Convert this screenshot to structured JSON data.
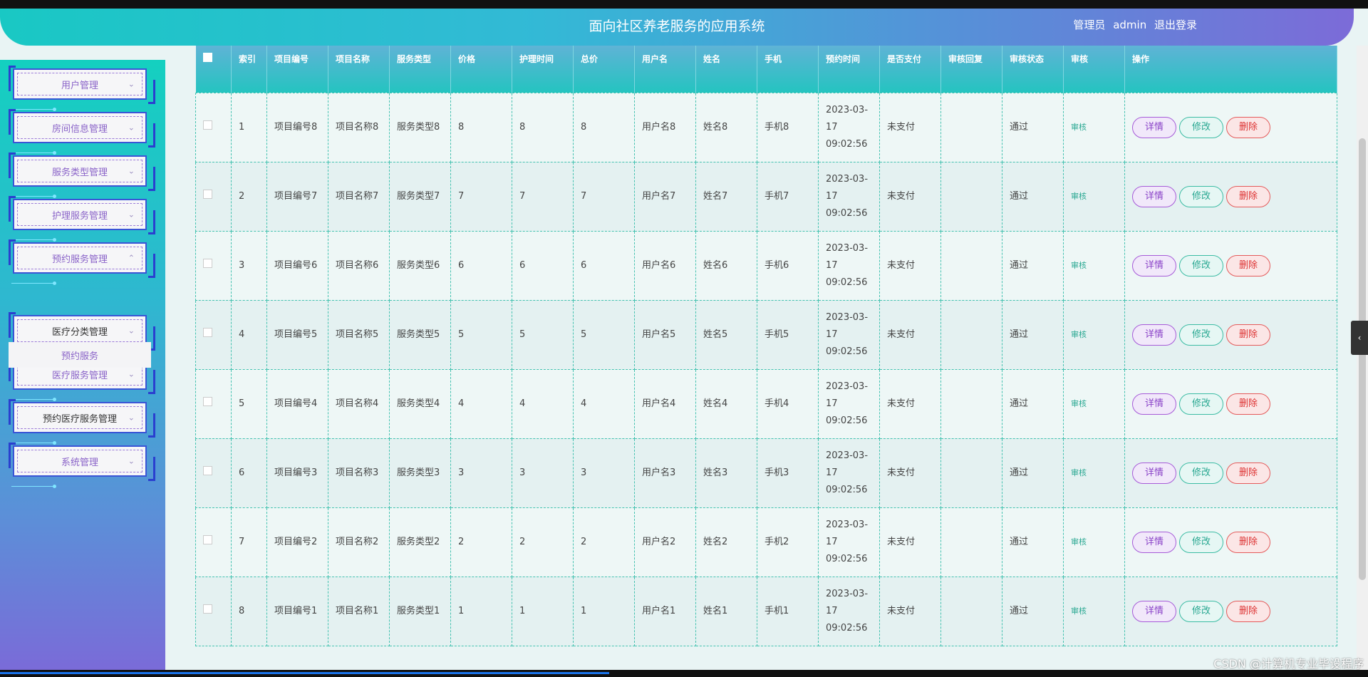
{
  "header": {
    "title": "面向社区养老服务的应用系统",
    "role": "管理员",
    "username": "admin",
    "logout": "退出登录"
  },
  "sidebar": {
    "items": [
      {
        "label": "用户管理"
      },
      {
        "label": "房间信息管理"
      },
      {
        "label": "服务类型管理"
      },
      {
        "label": "护理服务管理"
      },
      {
        "label": "预约服务管理"
      },
      {
        "label": "医疗分类管理"
      },
      {
        "label": "医疗服务管理"
      },
      {
        "label": "预约医疗服务管理"
      },
      {
        "label": "系统管理"
      }
    ],
    "submenu_label": "预约服务"
  },
  "table": {
    "headers": [
      "索引",
      "项目编号",
      "项目名称",
      "服务类型",
      "价格",
      "护理时间",
      "总价",
      "用户名",
      "姓名",
      "手机",
      "预约时间",
      "是否支付",
      "审核回复",
      "审核状态",
      "审核",
      "操作"
    ],
    "audit_link": "审核",
    "buttons": {
      "detail": "详情",
      "edit": "修改",
      "delete": "删除"
    },
    "rows": [
      {
        "idx": "1",
        "code": "项目编号8",
        "name": "项目名称8",
        "type": "服务类型8",
        "price": "8",
        "time": "8",
        "total": "8",
        "user": "用户名8",
        "realname": "姓名8",
        "phone": "手机8",
        "date": "2023-03-17 09:02:56",
        "paid": "未支付",
        "reply": "",
        "status": "通过"
      },
      {
        "idx": "2",
        "code": "项目编号7",
        "name": "项目名称7",
        "type": "服务类型7",
        "price": "7",
        "time": "7",
        "total": "7",
        "user": "用户名7",
        "realname": "姓名7",
        "phone": "手机7",
        "date": "2023-03-17 09:02:56",
        "paid": "未支付",
        "reply": "",
        "status": "通过"
      },
      {
        "idx": "3",
        "code": "项目编号6",
        "name": "项目名称6",
        "type": "服务类型6",
        "price": "6",
        "time": "6",
        "total": "6",
        "user": "用户名6",
        "realname": "姓名6",
        "phone": "手机6",
        "date": "2023-03-17 09:02:56",
        "paid": "未支付",
        "reply": "",
        "status": "通过"
      },
      {
        "idx": "4",
        "code": "项目编号5",
        "name": "项目名称5",
        "type": "服务类型5",
        "price": "5",
        "time": "5",
        "total": "5",
        "user": "用户名5",
        "realname": "姓名5",
        "phone": "手机5",
        "date": "2023-03-17 09:02:56",
        "paid": "未支付",
        "reply": "",
        "status": "通过"
      },
      {
        "idx": "5",
        "code": "项目编号4",
        "name": "项目名称4",
        "type": "服务类型4",
        "price": "4",
        "time": "4",
        "total": "4",
        "user": "用户名4",
        "realname": "姓名4",
        "phone": "手机4",
        "date": "2023-03-17 09:02:56",
        "paid": "未支付",
        "reply": "",
        "status": "通过"
      },
      {
        "idx": "6",
        "code": "项目编号3",
        "name": "项目名称3",
        "type": "服务类型3",
        "price": "3",
        "time": "3",
        "total": "3",
        "user": "用户名3",
        "realname": "姓名3",
        "phone": "手机3",
        "date": "2023-03-17 09:02:56",
        "paid": "未支付",
        "reply": "",
        "status": "通过"
      },
      {
        "idx": "7",
        "code": "项目编号2",
        "name": "项目名称2",
        "type": "服务类型2",
        "price": "2",
        "time": "2",
        "total": "2",
        "user": "用户名2",
        "realname": "姓名2",
        "phone": "手机2",
        "date": "2023-03-17 09:02:56",
        "paid": "未支付",
        "reply": "",
        "status": "通过"
      },
      {
        "idx": "8",
        "code": "项目编号1",
        "name": "项目名称1",
        "type": "服务类型1",
        "price": "1",
        "time": "1",
        "total": "1",
        "user": "用户名1",
        "realname": "姓名1",
        "phone": "手机1",
        "date": "2023-03-17 09:02:56",
        "paid": "未支付",
        "reply": "",
        "status": "通过"
      }
    ]
  },
  "watermark": "CSDN @计算机专业毕设程序",
  "side_tab_icon": "chevron-left-icon",
  "colors": {
    "accent": "#24c4c0",
    "header_end": "#7c6bd8"
  }
}
